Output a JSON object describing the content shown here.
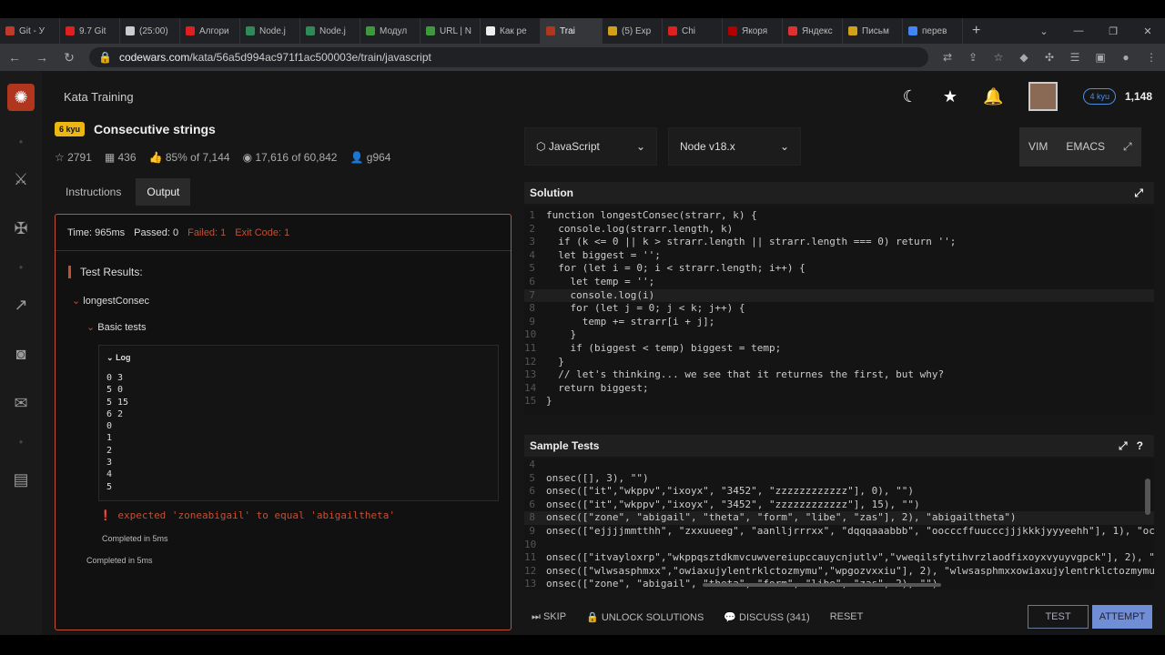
{
  "browser": {
    "tabs": [
      {
        "label": "Git - У",
        "color": "#c0392b"
      },
      {
        "label": "9.7 Git",
        "color": "#e02020"
      },
      {
        "label": "(25:00)",
        "color": "#cccccc"
      },
      {
        "label": "Алгори",
        "color": "#e02020"
      },
      {
        "label": "Node.j",
        "color": "#2e8b57"
      },
      {
        "label": "Node.j",
        "color": "#2e8b57"
      },
      {
        "label": "Модул",
        "color": "#3c9a3c"
      },
      {
        "label": "URL | N",
        "color": "#3c9a3c"
      },
      {
        "label": "Как ре",
        "color": "#eeeeee"
      },
      {
        "label": "Trai",
        "color": "#b1361e",
        "active": true
      },
      {
        "label": "(5) Exp",
        "color": "#d4a017"
      },
      {
        "label": "Chi",
        "color": "#e02020"
      },
      {
        "label": "Якоря",
        "color": "#b00000"
      },
      {
        "label": "Яндекс",
        "color": "#e03030"
      },
      {
        "label": "Письм",
        "color": "#d4a017"
      },
      {
        "label": "перев",
        "color": "#4285f4"
      }
    ],
    "url_host": "codewars.com",
    "url_path": "/kata/56a5d994ac971f1ac500003e/train/javascript"
  },
  "site": {
    "section": "Kata Training",
    "honor": "1,148",
    "user_rank": "4 kyu",
    "kata": {
      "rank": "6 kyu",
      "title": "Consecutive strings",
      "stars": "2791",
      "collections": "436",
      "satisfaction": "85% of 7,144",
      "completed": "17,616 of 60,842",
      "author": "g964"
    },
    "left_tabs": [
      "Instructions",
      "Output"
    ],
    "output": {
      "time": "Time: 965ms",
      "passed": "Passed: 0",
      "failed": "Failed: 1",
      "exit": "Exit Code: 1",
      "test_results": "Test Results:",
      "describe": "longestConsec",
      "it": "Basic tests",
      "log_title": "Log",
      "log_lines": [
        "0 3",
        "5 0",
        "5 15",
        "6 2",
        "0",
        "1",
        "2",
        "3",
        "4",
        "5"
      ],
      "error": "expected 'zoneabigail' to equal 'abigailtheta'",
      "completed_inner": "Completed in 5ms",
      "completed_outer": "Completed in 5ms"
    },
    "language": "JavaScript",
    "runtime": "Node v18.x",
    "editor_modes": [
      "VIM",
      "EMACS"
    ],
    "solution_label": "Solution",
    "sample_tests_label": "Sample Tests",
    "actions": {
      "skip": "SKIP",
      "unlock": "UNLOCK SOLUTIONS",
      "discuss": "DISCUSS (341)",
      "reset": "RESET",
      "test": "TEST",
      "attempt": "ATTEMPT"
    }
  },
  "code_lines": [
    "function longestConsec(strarr, k) {",
    "  console.log(strarr.length, k)",
    "  if (k <= 0 || k > strarr.length || strarr.length === 0) return '';",
    "  let biggest = '';",
    "  for (let i = 0; i < strarr.length; i++) {",
    "    let temp = '';",
    "    console.log(i)",
    "    for (let j = 0; j < k; j++) {",
    "      temp += strarr[i + j];",
    "    }",
    "    if (biggest < temp) biggest = temp;",
    "  }",
    "  // let's thinking... we see that it returnes the first, but why?",
    "  return biggest;",
    "}"
  ],
  "test_lines": [
    {
      "n": "4",
      "t": ""
    },
    {
      "n": "5",
      "t": "onsec([], 3), \"\")"
    },
    {
      "n": "6",
      "t": "onsec([\"it\",\"wkppv\",\"ixoyx\", \"3452\", \"zzzzzzzzzzzz\"], 0), \"\")"
    },
    {
      "n": "6",
      "t": "onsec([\"it\",\"wkppv\",\"ixoyx\", \"3452\", \"zzzzzzzzzzzz\"], 15), \"\")"
    },
    {
      "n": "8",
      "t": "onsec([\"zone\", \"abigail\", \"theta\", \"form\", \"libe\", \"zas\"], 2), \"abigailtheta\")"
    },
    {
      "n": "9",
      "t": "onsec([\"ejjjjmmtthh\", \"zxxuueeg\", \"aanlljrrrxx\", \"dqqqaaabbb\", \"oocccffuucccjjjkkkjyyyeehh\"], 1), \"oc"
    },
    {
      "n": "10",
      "t": ""
    },
    {
      "n": "11",
      "t": "onsec([\"itvayloxrp\",\"wkppqsztdkmvcuwvereiupccauycnjutlv\",\"vweqilsfytihvrzlaodfixoyxvyuyvgpck\"], 2), \"w"
    },
    {
      "n": "12",
      "t": "onsec([\"wlwsasphmxx\",\"owiaxujylentrklctozmymu\",\"wpgozvxxiu\"], 2), \"wlwsasphmxxowiaxujylentrklctozmymu"
    },
    {
      "n": "13",
      "t": "onsec([\"zone\", \"abigail\", \"theta\", \"form\", \"libe\", \"zas\", 2), \"\")"
    }
  ]
}
